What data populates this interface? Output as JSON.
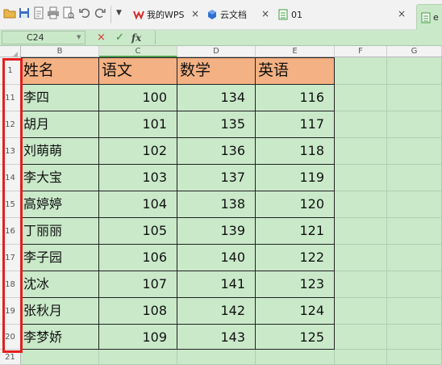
{
  "toolbar": {
    "tabs": [
      {
        "label": "我的WPS"
      },
      {
        "label": "云文档"
      },
      {
        "label": "01"
      },
      {
        "label": "e"
      }
    ],
    "close_glyph": "×",
    "dropdown_glyph": "▼"
  },
  "formula_bar": {
    "cell_ref": "C24",
    "cancel_glyph": "×",
    "confirm_glyph": "✓",
    "fx_label": "fx"
  },
  "columns": [
    "B",
    "C",
    "D",
    "E",
    "F",
    "G"
  ],
  "row_numbers": [
    "1",
    "11",
    "12",
    "13",
    "14",
    "15",
    "16",
    "17",
    "18",
    "19",
    "20",
    "21"
  ],
  "table": {
    "headers": [
      "姓名",
      "语文",
      "数学",
      "英语"
    ],
    "rows": [
      [
        "李四",
        "100",
        "134",
        "116"
      ],
      [
        "胡月",
        "101",
        "135",
        "117"
      ],
      [
        "刘萌萌",
        "102",
        "136",
        "118"
      ],
      [
        "李大宝",
        "103",
        "137",
        "119"
      ],
      [
        "高婷婷",
        "104",
        "138",
        "120"
      ],
      [
        "丁丽丽",
        "105",
        "139",
        "121"
      ],
      [
        "李子园",
        "106",
        "140",
        "122"
      ],
      [
        "沈冰",
        "107",
        "141",
        "123"
      ],
      [
        "张秋月",
        "108",
        "142",
        "124"
      ],
      [
        "李梦娇",
        "109",
        "143",
        "125"
      ]
    ]
  },
  "colors": {
    "sheet_background": "#c9e9c9",
    "header_fill": "#f4b183",
    "highlight_border": "#e31f1f"
  }
}
